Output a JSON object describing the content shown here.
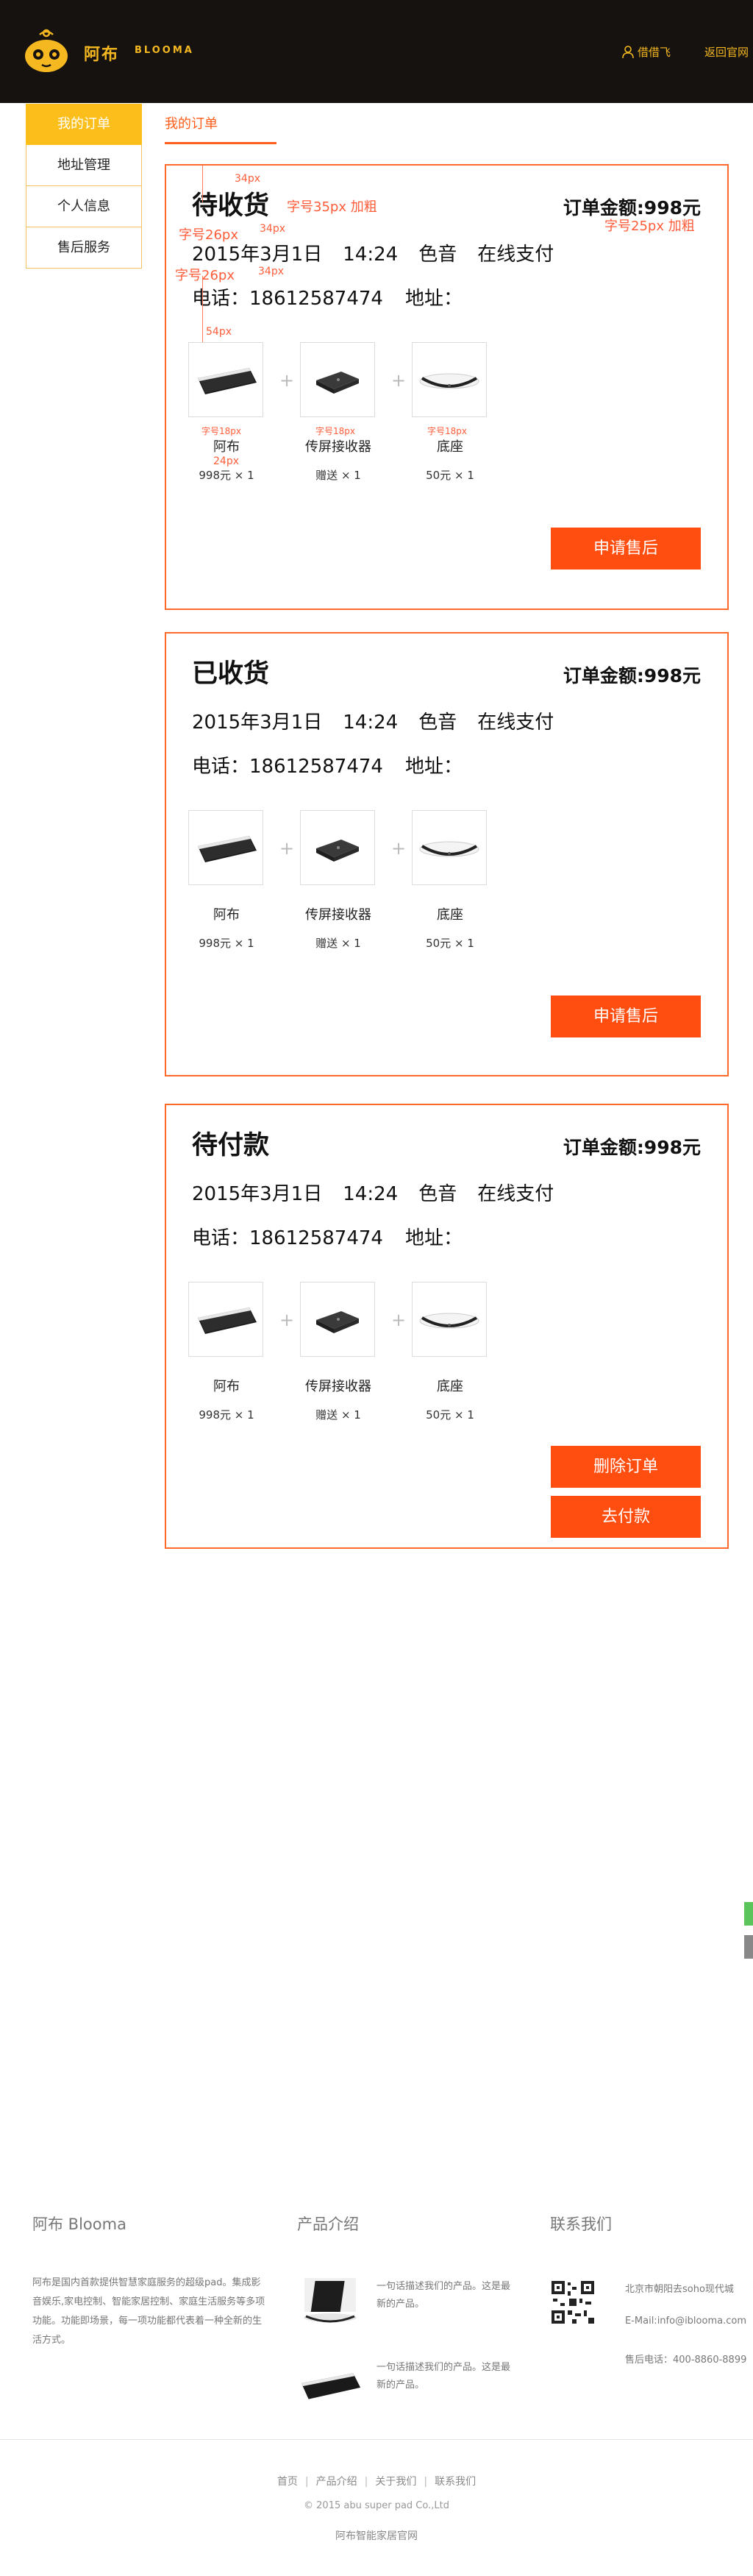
{
  "colors": {
    "accent": "#ff4e10",
    "brand_yellow": "#f5b820",
    "header_bg": "#16120f",
    "sidebar_active": "#fbbe1b"
  },
  "header": {
    "brand_cn": "阿布",
    "brand_en": "BLOOMA",
    "user_name": "借借飞",
    "home_link": "返回官网",
    "user_icon": "user-icon"
  },
  "sidebar": {
    "items": [
      {
        "label": "我的订单",
        "active": true
      },
      {
        "label": "地址管理"
      },
      {
        "label": "个人信息"
      },
      {
        "label": "售后服务"
      }
    ]
  },
  "tab": {
    "label": "我的订单"
  },
  "annotations": {
    "a1": "34px",
    "a2": "字号35px 加粗",
    "a3": "34px",
    "a4": "字号26px",
    "a5": "字号25px 加粗",
    "a6": "字号26px",
    "a7": "34px",
    "a8": "54px",
    "a9": "字号18px",
    "a10": "字号18px",
    "a11": "字号18px",
    "a12": "24px"
  },
  "orders": [
    {
      "status": "待收货",
      "amount": "订单金额:998元",
      "date": "2015年3月1日",
      "time": "14:24",
      "color": "色音",
      "payment": "在线支付",
      "phone": "电话：18612587474",
      "address": "地址：",
      "products": [
        {
          "name": "阿布",
          "price": "998元 × 1"
        },
        {
          "name": "传屏接收器",
          "price": "赠送   × 1"
        },
        {
          "name": "底座",
          "price": "50元   × 1"
        }
      ],
      "buttons": [
        "申请售后"
      ]
    },
    {
      "status": "已收货",
      "amount": "订单金额:998元",
      "date": "2015年3月1日",
      "time": "14:24",
      "color": "色音",
      "payment": "在线支付",
      "phone": "电话：18612587474",
      "address": "地址：",
      "products": [
        {
          "name": "阿布",
          "price": "998元 × 1"
        },
        {
          "name": "传屏接收器",
          "price": "赠送   × 1"
        },
        {
          "name": "底座",
          "price": "50元   × 1"
        }
      ],
      "buttons": [
        "申请售后"
      ]
    },
    {
      "status": "待付款",
      "amount": "订单金额:998元",
      "date": "2015年3月1日",
      "time": "14:24",
      "color": "色音",
      "payment": "在线支付",
      "phone": "电话：18612587474",
      "address": "地址：",
      "products": [
        {
          "name": "阿布",
          "price": "998元 × 1"
        },
        {
          "name": "传屏接收器",
          "price": "赠送   × 1"
        },
        {
          "name": "底座",
          "price": "50元   × 1"
        }
      ],
      "buttons": [
        "删除订单",
        "去付款"
      ]
    }
  ],
  "footer": {
    "col1_title": "阿布 Blooma",
    "col1_text": "阿布是国内首款提供智慧家庭服务的超级pad。集成影音娱乐,家电控制、智能家居控制、家庭生活服务等多项功能。功能即场景，每一项功能都代表着一种全新的生活方式。",
    "col2_title": "产品介绍",
    "col2_items": [
      "一句话描述我们的产品。这是最新的产品。",
      "一句话描述我们的产品。这是最新的产品。"
    ],
    "col3_title": "联系我们",
    "address": "北京市朝阳去soho现代城",
    "email": "E-Mail:info@iblooma.com",
    "phone": "售后电话：400-8860-8899",
    "links": [
      "首页",
      "产品介绍",
      "关于我们",
      "联系我们"
    ],
    "copyright": "© 2015 abu super pad Co.,Ltd",
    "site_name": "阿布智能家居官网"
  }
}
